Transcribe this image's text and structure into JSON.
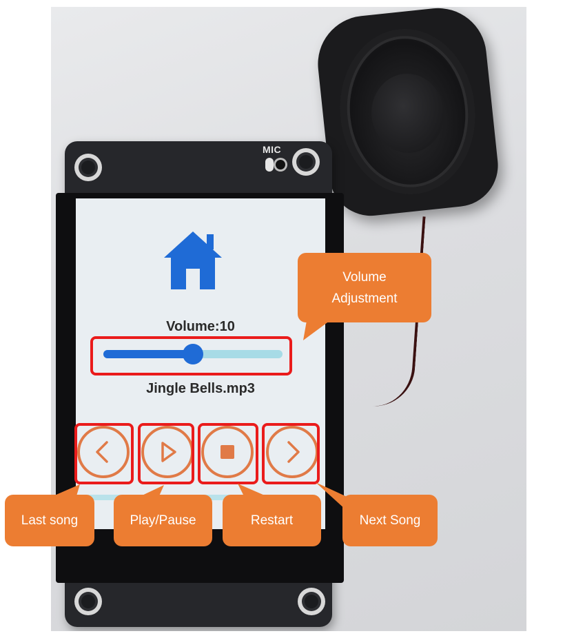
{
  "device": {
    "mic_label": "MIC"
  },
  "screen": {
    "home_icon": "home-icon",
    "volume_label": "Volume:10",
    "volume_level_fraction": 0.5,
    "song_name": "Jingle Bells.mp3",
    "buttons": [
      {
        "icon": "chevron-left-icon"
      },
      {
        "icon": "play-icon"
      },
      {
        "icon": "stop-icon"
      },
      {
        "icon": "chevron-right-icon"
      }
    ]
  },
  "callouts": {
    "volume": "Volume\nAdjustment",
    "last_song": "Last song",
    "play_pause": "Play/Pause",
    "restart": "Restart",
    "next_song": "Next Song"
  },
  "colors": {
    "accent_blue": "#1f6bd6",
    "button_orange": "#e07a47",
    "highlight_red": "#ea1b1b",
    "callout_orange": "#ec7d32"
  }
}
